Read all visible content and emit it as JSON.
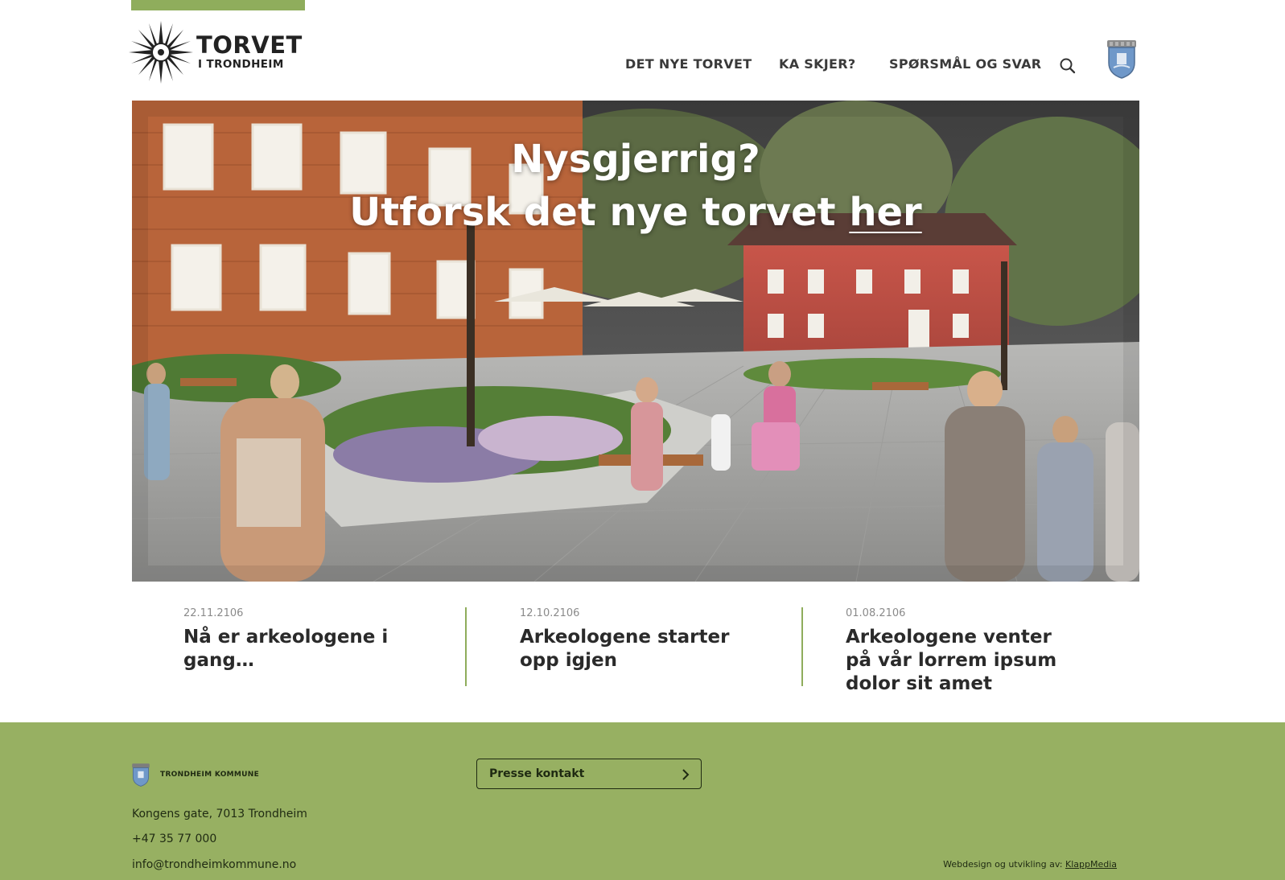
{
  "brand": {
    "title": "TORVET",
    "subtitle": "I TRONDHEIM",
    "accent_color": "#8fad5c"
  },
  "nav": {
    "items": [
      {
        "label": "DET NYE TORVET"
      },
      {
        "label": "KA SKJER?"
      },
      {
        "label": "SPØRSMÅL OG SVAR"
      }
    ],
    "search_icon": "search-icon",
    "crest_icon": "trondheim-crest-icon"
  },
  "hero": {
    "line1": "Nysgjerrig?",
    "line2_prefix": "Utforsk det nye torvet ",
    "link_text": "her"
  },
  "news": [
    {
      "date": "22.11.2106",
      "title": "Nå er arkeologene i gang…"
    },
    {
      "date": "12.10.2106",
      "title": "Arkeologene starter opp igjen"
    },
    {
      "date": "01.08.2106",
      "title": "Arkeologene venter på vår lorrem ipsum dolor sit amet"
    }
  ],
  "footer": {
    "kommune_name": "TRONDHEIM KOMMUNE",
    "address": "Kongens gate, 7013 Trondheim",
    "phone": "+47 35 77 000",
    "email": "info@trondheimkommune.no",
    "press_button": "Presse kontakt",
    "credit_prefix": "Webdesign og utvikling av:",
    "credit_link": "KlappMedia",
    "background_color": "#97b062"
  }
}
